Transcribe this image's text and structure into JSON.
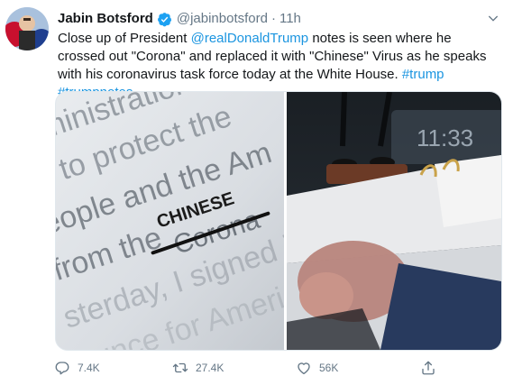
{
  "tweet": {
    "author_name": "Jabin Botsford",
    "handle": "@jabinbotsford",
    "separator": "·",
    "time": "11h",
    "text_parts": [
      "Close up of President ",
      "@realDonaldTrump",
      " notes is seen where he crossed out \"Corona\" and replaced it with \"Chinese\" Virus as he speaks with his coronavirus task force today at the White House. ",
      "#trump",
      " ",
      "#trumpnotes"
    ]
  },
  "photos": {
    "left_note_lines": [
      "ministration",
      "y to protect the",
      "eople and the Am",
      "from the",
      "sterday, I signed in",
      "bunce for Americ"
    ],
    "left_handwriting": "CHINESE",
    "left_crossed_word": "Corona",
    "right_clock": "11:33"
  },
  "actions": {
    "reply_count": "7.4K",
    "retweet_count": "27.4K",
    "like_count": "56K"
  },
  "colors": {
    "link": "#1b95e0",
    "secondary_text": "#657786",
    "verified": "#1da1f2"
  }
}
